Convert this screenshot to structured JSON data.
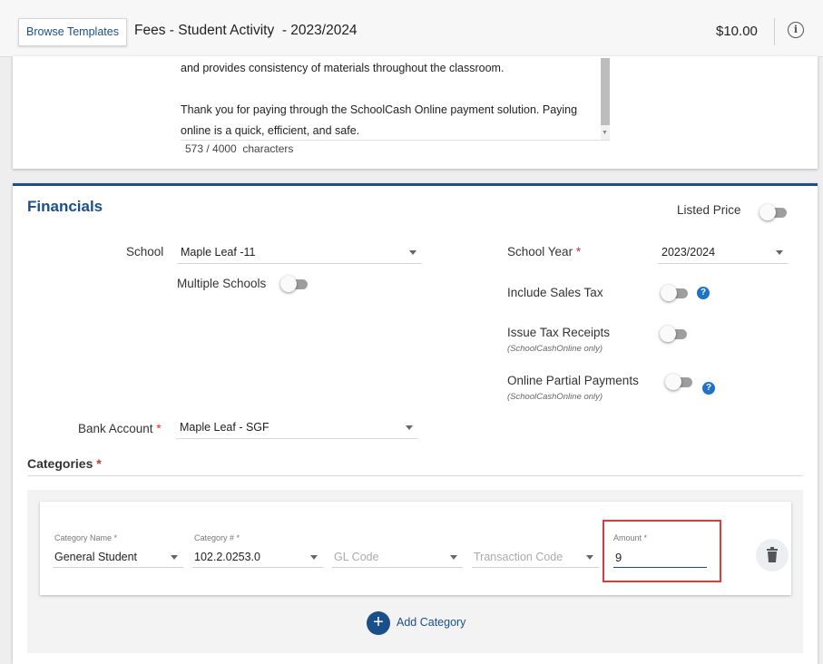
{
  "header": {
    "browse_templates_label": "Browse Templates",
    "title": "Fees - Student Activity  - 2023/2024",
    "total": "$10.00"
  },
  "description": {
    "line1": "and provides consistency of materials throughout the classroom.",
    "line2": "Thank you for paying through the SchoolCash Online payment solution.  Paying",
    "line3": "online is a quick, efficient, and safe.",
    "char_count": "573 / 4000  characters"
  },
  "financials": {
    "title": "Financials",
    "listed_price_label": "Listed Price",
    "school_label": "School",
    "school_value": "Maple Leaf -11",
    "multiple_schools_label": "Multiple Schools",
    "school_year_label": "School Year",
    "school_year_value": "2023/2024",
    "include_sales_tax_label": "Include Sales Tax",
    "issue_tax_receipts_label": "Issue Tax Receipts",
    "issue_tax_receipts_sub": "(SchoolCashOnline only)",
    "online_partial_label": "Online Partial Payments",
    "online_partial_sub": "(SchoolCashOnline only)",
    "bank_account_label": "Bank Account",
    "bank_account_value": "Maple Leaf - SGF",
    "required_mark": "*"
  },
  "categories": {
    "label": "Categories",
    "row": {
      "category_name_label": "Category Name *",
      "category_name_value": "General Student",
      "category_num_label": "Category # *",
      "category_num_value": "102.2.0253.0",
      "gl_code_placeholder": "GL Code",
      "transaction_code_placeholder": "Transaction Code",
      "amount_label": "Amount *",
      "amount_value": "9"
    },
    "add_label": "Add Category"
  },
  "colors": {
    "brand": "#1a4f8a",
    "help": "#1e73c9",
    "highlight": "#e53935"
  }
}
